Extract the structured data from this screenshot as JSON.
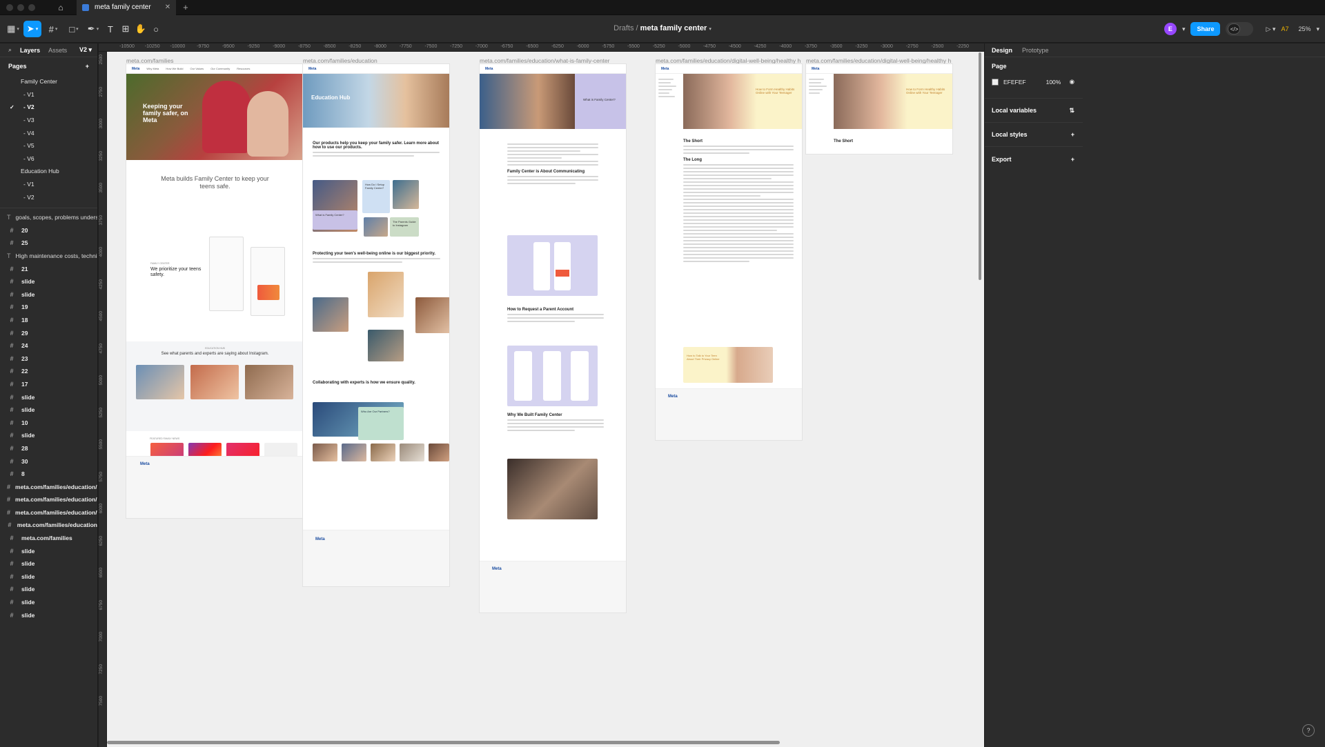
{
  "window": {
    "tab_title": "meta family center",
    "new_tab": "+"
  },
  "toolbar": {
    "breadcrumb_parent": "Drafts",
    "breadcrumb_sep": "/",
    "file_name": "meta family center",
    "avatar_initial": "E",
    "share_label": "Share",
    "ai_label": "A7",
    "zoom": "25%"
  },
  "left_panel": {
    "tab_layers": "Layers",
    "tab_assets": "Assets",
    "version": "V2",
    "pages_heading": "Pages",
    "pages": [
      {
        "label": "Family Center",
        "level": 0,
        "selected": false
      },
      {
        "label": "- V1",
        "level": 1,
        "selected": false
      },
      {
        "label": "- V2",
        "level": 1,
        "selected": true
      },
      {
        "label": "- V3",
        "level": 1,
        "selected": false
      },
      {
        "label": "- V4",
        "level": 1,
        "selected": false
      },
      {
        "label": "- V5",
        "level": 1,
        "selected": false
      },
      {
        "label": "- V6",
        "level": 1,
        "selected": false
      },
      {
        "label": "Education Hub",
        "level": 0,
        "selected": false
      },
      {
        "label": "- V1",
        "level": 1,
        "selected": false
      },
      {
        "label": "- V2",
        "level": 1,
        "selected": false
      }
    ],
    "layers": [
      {
        "label": "goals, scopes, problems understa...",
        "type": "text"
      },
      {
        "label": "20",
        "type": "frame"
      },
      {
        "label": "25",
        "type": "frame"
      },
      {
        "label": "High maintenance costs, technical...",
        "type": "text"
      },
      {
        "label": "21",
        "type": "frame"
      },
      {
        "label": "slide",
        "type": "frame"
      },
      {
        "label": "slide",
        "type": "frame"
      },
      {
        "label": "19",
        "type": "frame"
      },
      {
        "label": "18",
        "type": "frame"
      },
      {
        "label": "29",
        "type": "frame"
      },
      {
        "label": "24",
        "type": "frame"
      },
      {
        "label": "23",
        "type": "frame"
      },
      {
        "label": "22",
        "type": "frame"
      },
      {
        "label": "17",
        "type": "frame"
      },
      {
        "label": "slide",
        "type": "frame"
      },
      {
        "label": "slide",
        "type": "frame"
      },
      {
        "label": "10",
        "type": "frame"
      },
      {
        "label": "slide",
        "type": "frame"
      },
      {
        "label": "28",
        "type": "frame"
      },
      {
        "label": "30",
        "type": "frame"
      },
      {
        "label": "8",
        "type": "frame"
      },
      {
        "label": "meta.com/families/education/digi...",
        "type": "frame"
      },
      {
        "label": "meta.com/families/education/digi...",
        "type": "frame"
      },
      {
        "label": "meta.com/families/education/wh...",
        "type": "frame"
      },
      {
        "label": "meta.com/families/education",
        "type": "frame"
      },
      {
        "label": "meta.com/families",
        "type": "frame"
      },
      {
        "label": "slide",
        "type": "frame"
      },
      {
        "label": "slide",
        "type": "frame"
      },
      {
        "label": "slide",
        "type": "frame"
      },
      {
        "label": "slide",
        "type": "frame"
      },
      {
        "label": "slide",
        "type": "frame"
      },
      {
        "label": "slide",
        "type": "frame"
      }
    ]
  },
  "ruler_top": [
    "-10500",
    "-10250",
    "-10000",
    "-9750",
    "-9500",
    "-9250",
    "-9000",
    "-8750",
    "-8500",
    "-8250",
    "-8000",
    "-7750",
    "-7500",
    "-7250",
    "-7000",
    "-6750",
    "-6500",
    "-6250",
    "-6000",
    "-5750",
    "-5500",
    "-5250",
    "-5000",
    "-4750",
    "-4500",
    "-4250",
    "-4000",
    "-3750",
    "-3500",
    "-3250",
    "-3000",
    "-2750",
    "-2500",
    "-2250"
  ],
  "ruler_left": [
    "2500",
    "2750",
    "3000",
    "3250",
    "3500",
    "3750",
    "4000",
    "4250",
    "4500",
    "4750",
    "5000",
    "5250",
    "5500",
    "5750",
    "6000",
    "6250",
    "6500",
    "6750",
    "7000",
    "7250",
    "7500"
  ],
  "frames": [
    {
      "label": "meta.com/families",
      "nav": [
        "Meta",
        "Why Meta",
        "How We Build",
        "Our Values",
        "Our Community",
        "Resources"
      ],
      "hero_text": "Keeping your family safer, on Meta",
      "tagline": "Meta builds Family Center to keep your teens safe.",
      "family_center": "FAMILY CENTER",
      "prioritize": "We prioritize your teens safety.",
      "edu_hub": "EDUCATION HUB",
      "see_what": "See what parents and experts are saying about Instagram.",
      "featured": "FEATURED FAMILY NEWS",
      "footer_logo": "Meta"
    },
    {
      "label": "meta.com/families/education",
      "hero_text": "Education Hub",
      "h1": "Our products help you keep your family safer. Learn more about how to use our products.",
      "card1": "What is Family Center?",
      "card2": "How Do I Setup Family Center?",
      "card3": "The Parents Guide to Instagram",
      "h2": "Protecting your teen's well-being online is our biggest priority.",
      "h3": "Collaborating with experts is how we ensure quality.",
      "card4": "Who Are Our Partners?",
      "footer_logo": "Meta"
    },
    {
      "label": "meta.com/families/education/what-is-family-center",
      "hero_text": "What is Family Center?",
      "h1": "Family Center is About Communicating",
      "h2": "How to Request a Parent Account",
      "h3": "Why We Built Family Center",
      "footer_logo": "Meta"
    },
    {
      "label": "meta.com/families/education/digital-well-being/healthy habits",
      "hero_text": "How to Form Healthy Habits Online with Your Teenager",
      "short": "The Short",
      "long": "The Long",
      "next": "How to Talk to Your Teen About Their Privacy Online",
      "footer_logo": "Meta"
    },
    {
      "label": "meta.com/families/education/digital-well-being/healthy habits",
      "hero_text": "How to Form Healthy Habits Online with Your Teenager",
      "short": "The Short"
    }
  ],
  "right_panel": {
    "tab_design": "Design",
    "tab_prototype": "Prototype",
    "page_heading": "Page",
    "fill_hex": "EFEFEF",
    "fill_opacity": "100%",
    "local_variables": "Local variables",
    "local_styles": "Local styles",
    "export": "Export"
  },
  "help": "?",
  "colors": {
    "accent": "#0d99ff",
    "canvas": "#efefef",
    "panel": "#2c2c2c",
    "avatar": "#9747ff"
  }
}
